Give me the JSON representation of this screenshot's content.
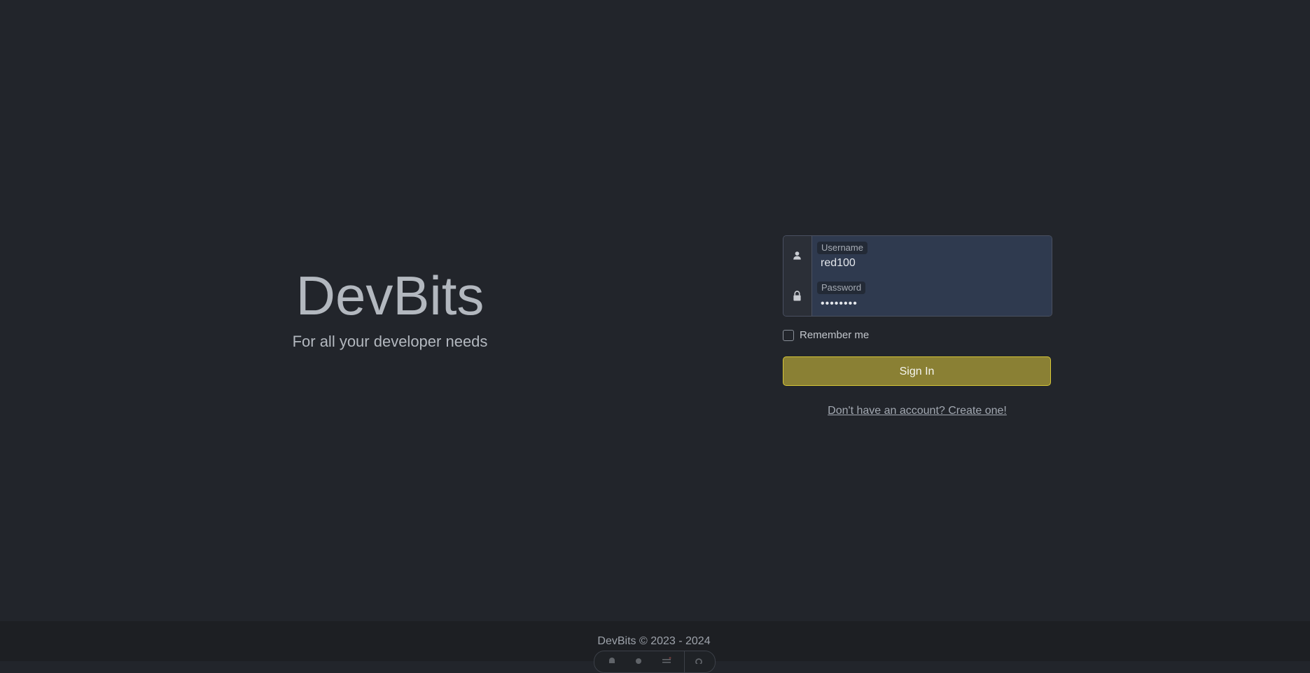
{
  "brand": {
    "title": "DevBits",
    "tagline": "For all your developer needs"
  },
  "login": {
    "username_label": "Username",
    "username_value": "red100",
    "password_label": "Password",
    "password_value": "••••••••",
    "remember_label": "Remember me",
    "remember_checked": false,
    "signin_label": "Sign In",
    "create_account_link": "Don't have an account? Create one!"
  },
  "footer": {
    "text": "DevBits © 2023 - 2024",
    "toolbar_icons": [
      "bell-icon",
      "bug-icon",
      "menu-icon",
      "gear-icon"
    ]
  },
  "colors": {
    "background": "#22252b",
    "footer_background": "#1d1f23",
    "input_background": "#2f3a4f",
    "signin_button": "#8a8034",
    "signin_border": "#d6c637"
  }
}
